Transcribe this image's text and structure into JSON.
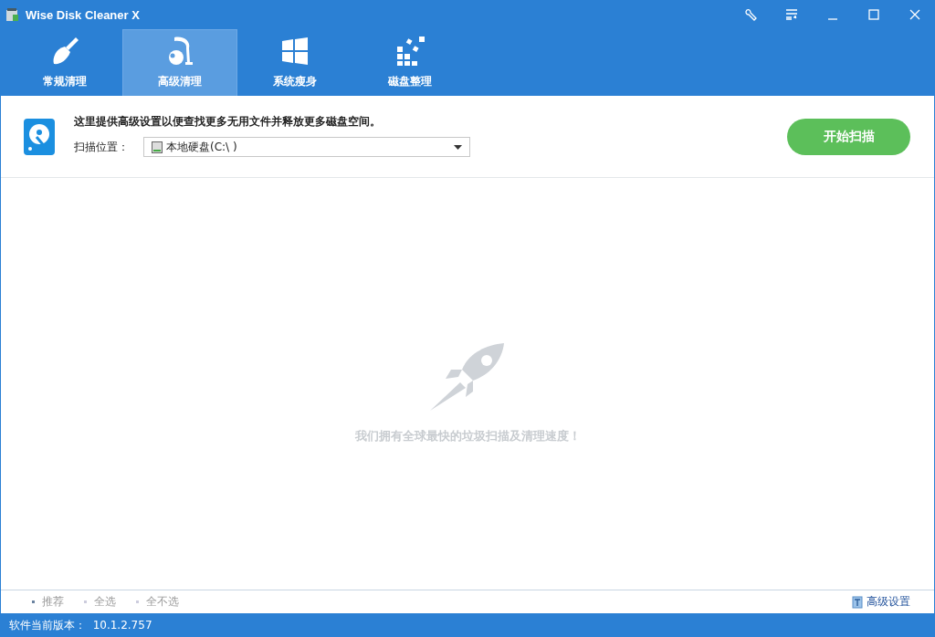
{
  "window": {
    "title": "Wise Disk Cleaner X"
  },
  "tabs": [
    {
      "label": "常规清理",
      "kind": "broom",
      "selected": false
    },
    {
      "label": "高级清理",
      "kind": "vacuum",
      "selected": true
    },
    {
      "label": "系统瘦身",
      "kind": "windows",
      "selected": false
    },
    {
      "label": "磁盘整理",
      "kind": "blocks",
      "selected": false
    }
  ],
  "header": {
    "description": "这里提供高级设置以便查找更多无用文件并释放更多磁盘空间。",
    "location_label": "扫描位置：",
    "location_value": "本地硬盘(C:\\ )",
    "scan_button": "开始扫描"
  },
  "empty_message": "我们拥有全球最快的垃圾扫描及清理速度！",
  "footer": {
    "links": [
      {
        "label": "推荐",
        "selected": true
      },
      {
        "label": "全选",
        "selected": false
      },
      {
        "label": "全不选",
        "selected": false
      }
    ],
    "settings": "高级设置"
  },
  "status_bar": {
    "version": "软件当前版本：  10.1.2.757"
  }
}
